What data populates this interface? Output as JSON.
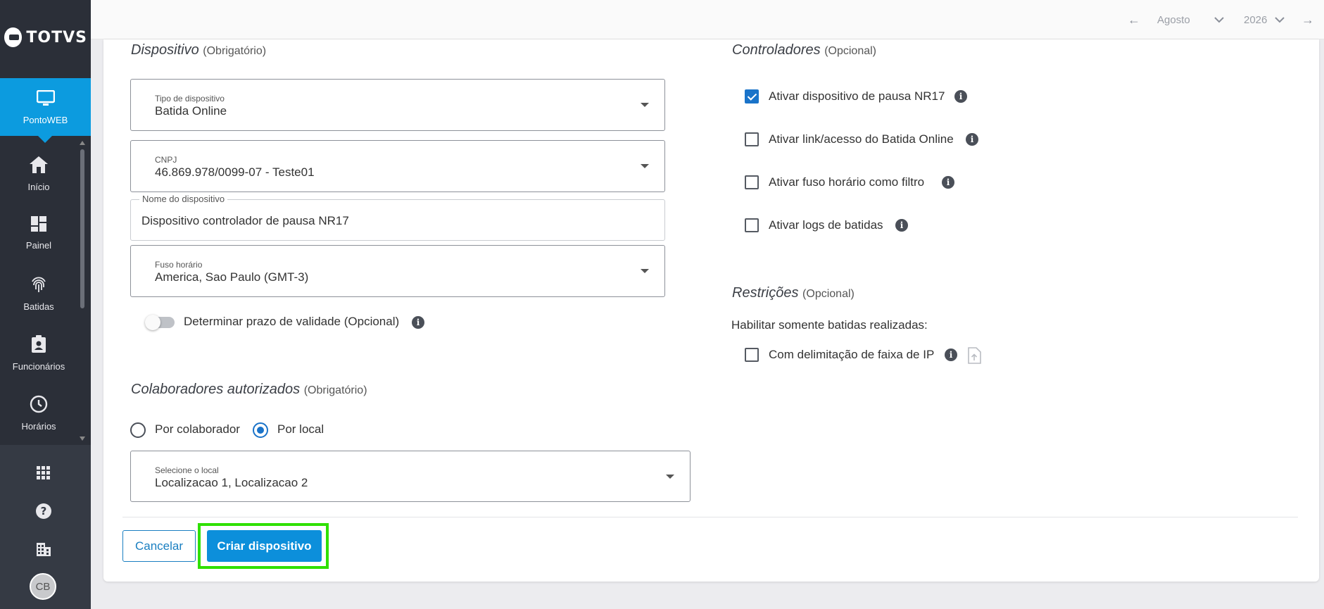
{
  "brand": {
    "logo_text": "TOTVS"
  },
  "sidebar": {
    "active": {
      "label": "PontoWEB",
      "icon": "monitor-icon"
    },
    "items": [
      {
        "label": "Início",
        "icon": "home-icon"
      },
      {
        "label": "Painel",
        "icon": "dashboard-icon"
      },
      {
        "label": "Batidas",
        "icon": "fingerprint-icon"
      },
      {
        "label": "Funcionários",
        "icon": "badge-icon"
      },
      {
        "label": "Horários",
        "icon": "clock-icon"
      }
    ],
    "tools": [
      "apps-grid-icon",
      "help-icon",
      "building-icon"
    ],
    "avatar": "CB"
  },
  "topbar": {
    "month": "Agosto",
    "year": "2026"
  },
  "dispositivo": {
    "title": "Dispositivo",
    "subtitle": "(Obrigatório)",
    "tipo": {
      "label": "Tipo de dispositivo",
      "value": "Batida Online"
    },
    "cnpj": {
      "label": "CNPJ",
      "value": "46.869.978/0099-07 - Teste01"
    },
    "nome": {
      "label": "Nome do dispositivo",
      "value": "Dispositivo controlador de pausa NR17"
    },
    "fuso": {
      "label": "Fuso horário",
      "value": "America, Sao Paulo (GMT-3)"
    },
    "validade": {
      "label": "Determinar prazo de validade (Opcional)",
      "enabled": false
    }
  },
  "colaboradores": {
    "title": "Colaboradores autorizados",
    "subtitle": "(Obrigatório)",
    "options": [
      {
        "label": "Por colaborador",
        "selected": false
      },
      {
        "label": "Por local",
        "selected": true
      }
    ],
    "local": {
      "label": "Selecione o local",
      "value": "Localizacao 1, Localizacao 2"
    }
  },
  "controladores": {
    "title": "Controladores",
    "subtitle": "(Opcional)",
    "items": [
      {
        "label": "Ativar dispositivo de pausa NR17",
        "checked": true
      },
      {
        "label": "Ativar link/acesso do Batida Online",
        "checked": false
      },
      {
        "label": "Ativar fuso horário como filtro",
        "checked": false
      },
      {
        "label": "Ativar logs de batidas",
        "checked": false
      }
    ]
  },
  "restricoes": {
    "title": "Restrições",
    "subtitle": "(Opcional)",
    "text": "Habilitar somente batidas realizadas:",
    "ip": {
      "label": "Com delimitação de faixa de IP",
      "checked": false
    }
  },
  "actions": {
    "cancel": "Cancelar",
    "create": "Criar dispositivo"
  },
  "colors": {
    "primary": "#0c8fdb",
    "sidebar": "#2b2f38",
    "highlight": "#2fe000"
  }
}
